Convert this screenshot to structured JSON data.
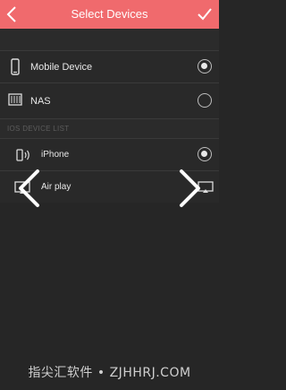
{
  "header": {
    "title": "Select Devices",
    "back_icon": "chevron-left-icon",
    "confirm_icon": "checkmark-icon",
    "color": "#f06a6d"
  },
  "devices": [
    {
      "label": "Mobile Device",
      "icon": "phone-icon",
      "selected": true
    },
    {
      "label": "NAS",
      "icon": "nas-icon",
      "selected": false
    }
  ],
  "ios_section": {
    "title": "IOS DEVICE LIST",
    "items": [
      {
        "label": "iPhone",
        "icon": "wireless-icon",
        "selected": true
      },
      {
        "label": "Air play",
        "icon": "airplay-icon",
        "selected": false
      }
    ]
  },
  "overlay": {
    "prev_icon": "chevron-left-icon",
    "next_icon": "chevron-right-icon"
  },
  "watermark": "指尖汇软件 • ZJHHRJ.COM"
}
